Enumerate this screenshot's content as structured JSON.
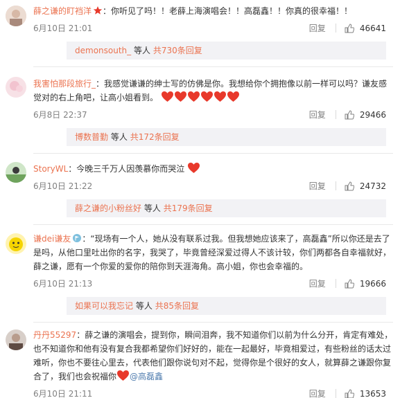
{
  "comments": [
    {
      "username": "薛之谦的盯裆洋",
      "text": "：你听见了吗！！老薛上海演唱会！！高磊鑫！！你真的很幸福！！",
      "time": "6月10日 21:01",
      "reply_label": "回复",
      "likes": "46641",
      "sub": {
        "user": "demonsouth_",
        "label": "等人",
        "more": "共730条回复"
      }
    },
    {
      "username": "我害怕那段旅行_",
      "text": "：我感觉谦谦的绅士写的仿佛是你。我想给你个拥抱像以前一样可以吗？谦友感觉对的右上角吧，让高小姐看到。",
      "time": "6月8日 22:37",
      "reply_label": "回复",
      "likes": "29466",
      "sub": {
        "user": "博数普勤",
        "label": "等人",
        "more": "共172条回复"
      }
    },
    {
      "username": "StoryWL",
      "text": "：今晚三千万人因羡慕你而哭泣",
      "time": "6月10日 21:22",
      "reply_label": "回复",
      "likes": "24732",
      "sub": {
        "user": "薛之谦的小粉丝好",
        "label": "等人",
        "more": "共179条回复"
      }
    },
    {
      "username": "谦dei谦友",
      "text": "：“现场有一个人，她从没有联系过我。但我想她应该来了，高磊鑫”所以你还是去了是吗，从他口里吐出你的名字，我哭了，毕竟曾经深爱过得人不该计较，你们两都各自幸福就好，薛之谦，愿有一个你爱的爱你的陪你到天涯海角。高小姐，你也会幸福的。",
      "time": "6月10日 21:13",
      "reply_label": "回复",
      "likes": "19666",
      "sub": {
        "user": "如果可以我忘记",
        "label": "等人",
        "more": "共85条回复"
      }
    },
    {
      "username": "丹丹55297",
      "text": "：薛之谦的演唱会，提到你，瞬间泪奔，我不知道你们以前为什么分开，肯定有难处，也不知道你和他有没有复合我都希望你们好好的，能在一起最好，毕竟相爱过，有些粉丝的话太过难听，你也不要往心里去，代表他们跟你说句对不起，觉得你是个很好的女人，就算薛之谦跟你复合了，我们也会祝福你",
      "mention": "@高磊鑫",
      "time": "6月10日 21:11",
      "reply_label": "回复",
      "likes": "13653"
    }
  ],
  "colors": {
    "name": "#eb7350",
    "link": "#507daf",
    "meta": "#808080",
    "heart": "#e8392b"
  },
  "icons": [
    "star-badge-icon",
    "flag-badge-icon",
    "heart-emoji-icon",
    "thumbs-up-icon"
  ]
}
